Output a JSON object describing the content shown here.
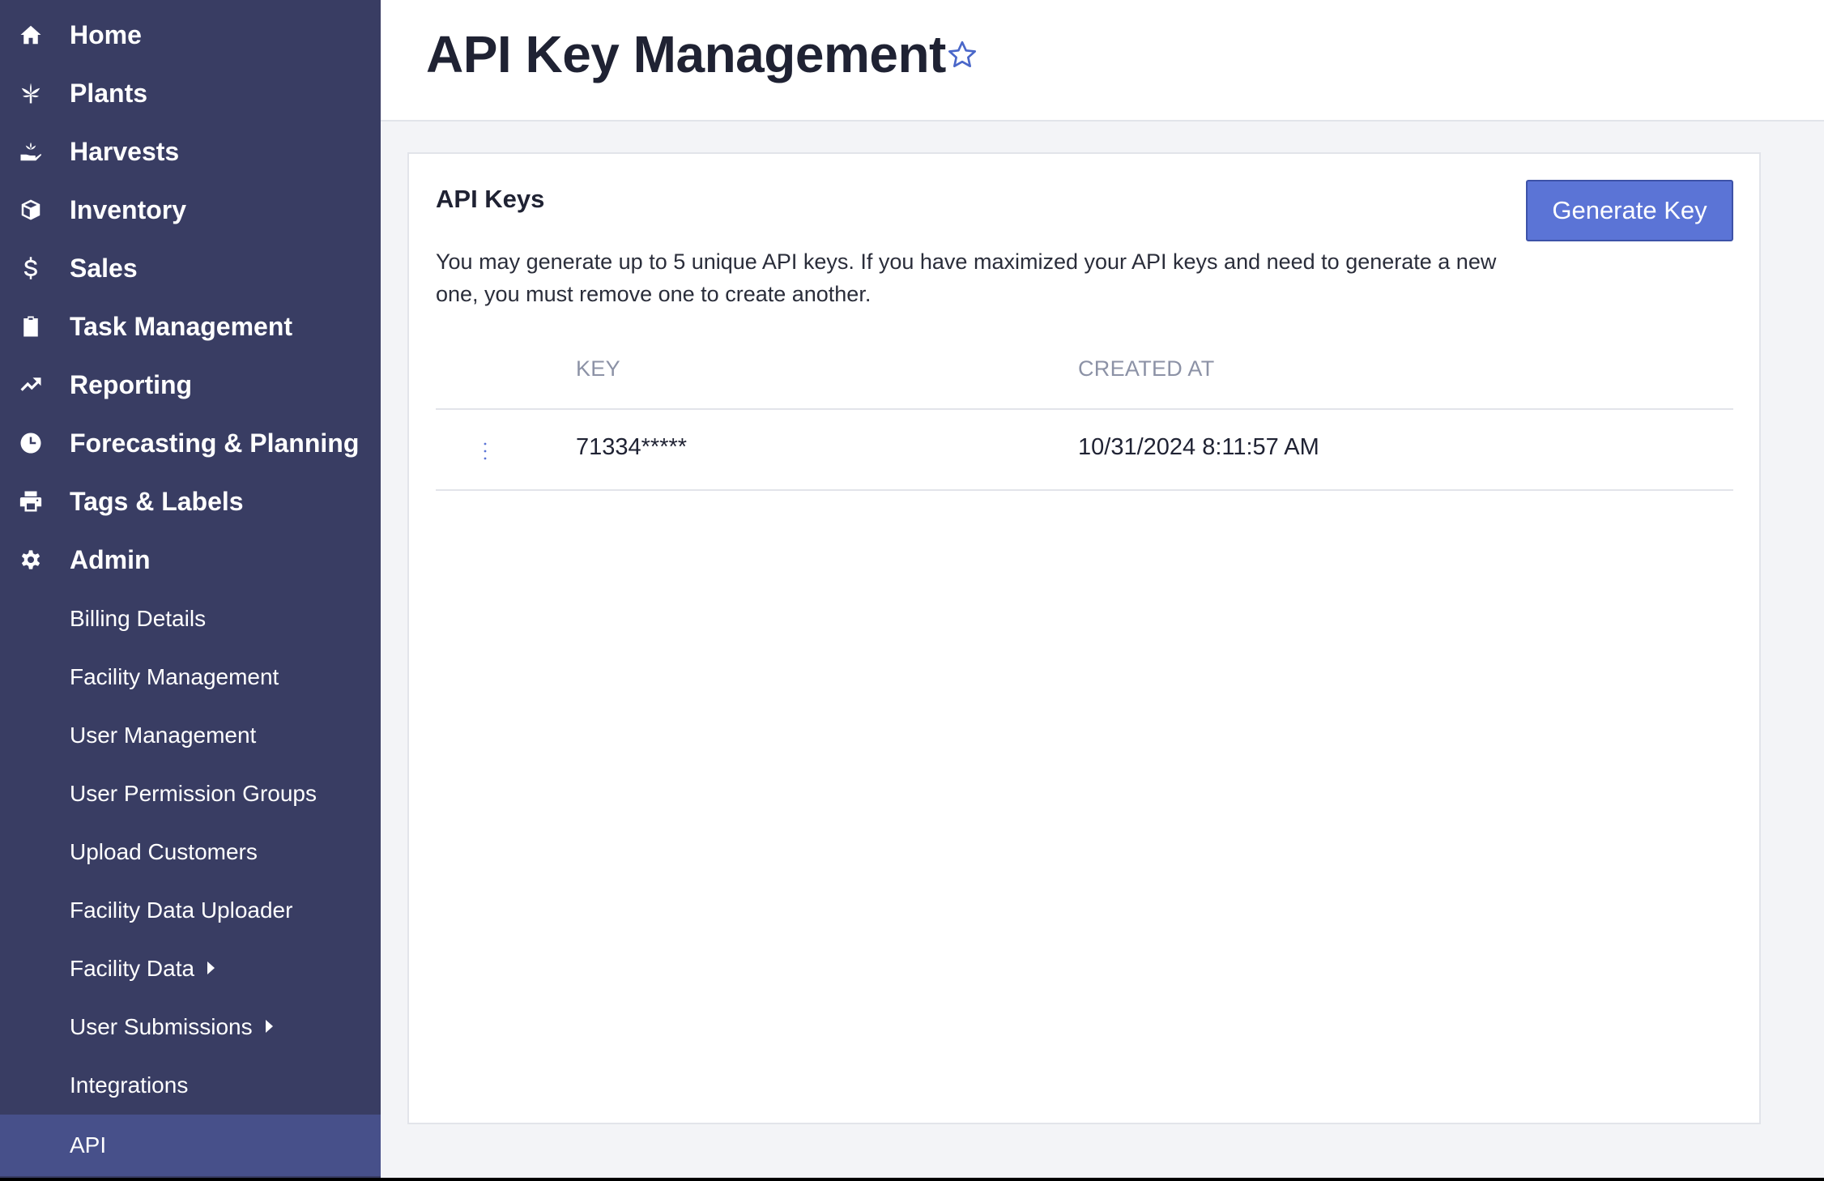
{
  "sidebar": {
    "items": [
      {
        "label": "Home",
        "icon": "home-icon"
      },
      {
        "label": "Plants",
        "icon": "leaf-icon"
      },
      {
        "label": "Harvests",
        "icon": "hand-holding-icon"
      },
      {
        "label": "Inventory",
        "icon": "box-icon"
      },
      {
        "label": "Sales",
        "icon": "dollar-icon"
      },
      {
        "label": "Task Management",
        "icon": "clipboard-check-icon"
      },
      {
        "label": "Reporting",
        "icon": "trending-up-icon"
      },
      {
        "label": "Forecasting & Planning",
        "icon": "clock-icon"
      },
      {
        "label": "Tags & Labels",
        "icon": "printer-icon"
      },
      {
        "label": "Admin",
        "icon": "gear-icon"
      }
    ],
    "admin_sub_items": [
      {
        "label": "Billing Details"
      },
      {
        "label": "Facility Management"
      },
      {
        "label": "User Management"
      },
      {
        "label": "User Permission Groups"
      },
      {
        "label": "Upload Customers"
      },
      {
        "label": "Facility Data Uploader"
      },
      {
        "label": "Facility Data",
        "has_caret": true
      },
      {
        "label": "User Submissions",
        "has_caret": true
      },
      {
        "label": "Integrations"
      },
      {
        "label": "API",
        "active": true
      }
    ]
  },
  "header": {
    "title": "API Key Management",
    "favorite_icon": "star-outline-icon"
  },
  "card": {
    "title": "API Keys",
    "description": "You may generate up to 5 unique API keys. If you have maximized your API keys and need to generate a new one, you must remove one to create another.",
    "generate_button_label": "Generate Key"
  },
  "table": {
    "columns": [
      "KEY",
      "CREATED AT"
    ],
    "rows": [
      {
        "key": "71334*****",
        "created_at": "10/31/2024 8:11:57 AM",
        "actions_icon": "kebab-menu-icon"
      }
    ]
  },
  "colors": {
    "sidebar_bg": "#393d63",
    "sidebar_active": "#47508a",
    "accent": "#5b74d6",
    "page_bg": "#f3f4f7"
  }
}
